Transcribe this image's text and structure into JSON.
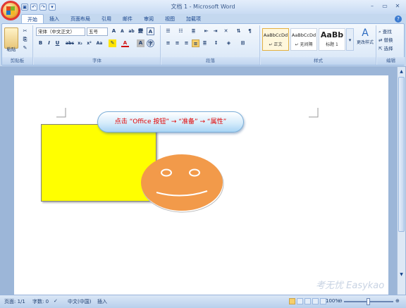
{
  "window": {
    "title": "文档 1 - Microsoft Word"
  },
  "qat": {
    "save": "▣",
    "undo": "↶",
    "redo": "↷",
    "more": "▾"
  },
  "tabs": [
    "开始",
    "插入",
    "页面布局",
    "引用",
    "邮件",
    "审阅",
    "视图",
    "加载项"
  ],
  "ribbon": {
    "clipboard": {
      "paste_label": "粘贴",
      "group_label": "剪贴板"
    },
    "font": {
      "font_name": "宋体（中文正文）",
      "font_size": "五号",
      "group_label": "字体",
      "row1": [
        "A",
        "A",
        "ab",
        "變",
        "A"
      ],
      "row2": [
        "B",
        "I",
        "U",
        "abc",
        "x₂",
        "x²",
        "Aa"
      ]
    },
    "paragraph": {
      "group_label": "段落"
    },
    "styles": {
      "group_label": "样式",
      "items": [
        {
          "sample": "AaBbCcDd",
          "name": "↵ 正文"
        },
        {
          "sample": "AaBbCcDd",
          "name": "↵ 无间隔"
        },
        {
          "sample": "AaBb",
          "name": "标题 1"
        }
      ],
      "change_styles": "更改样式"
    },
    "editing": {
      "group_label": "编辑",
      "find": "查找",
      "replace": "替换",
      "select": "选择"
    }
  },
  "document": {
    "callout_text": "点击 “Office 按钮” → “准备” → “属性”"
  },
  "statusbar": {
    "page": "页面: 1/1",
    "words": "字数: 0",
    "language": "中文(中国)",
    "insert": "插入",
    "zoom": "100%"
  },
  "watermark": "考无忧 Easykao",
  "colors": {
    "callout_text": "#e00000",
    "yellow_rect": "#ffff00",
    "smiley": "#f29a4a"
  }
}
